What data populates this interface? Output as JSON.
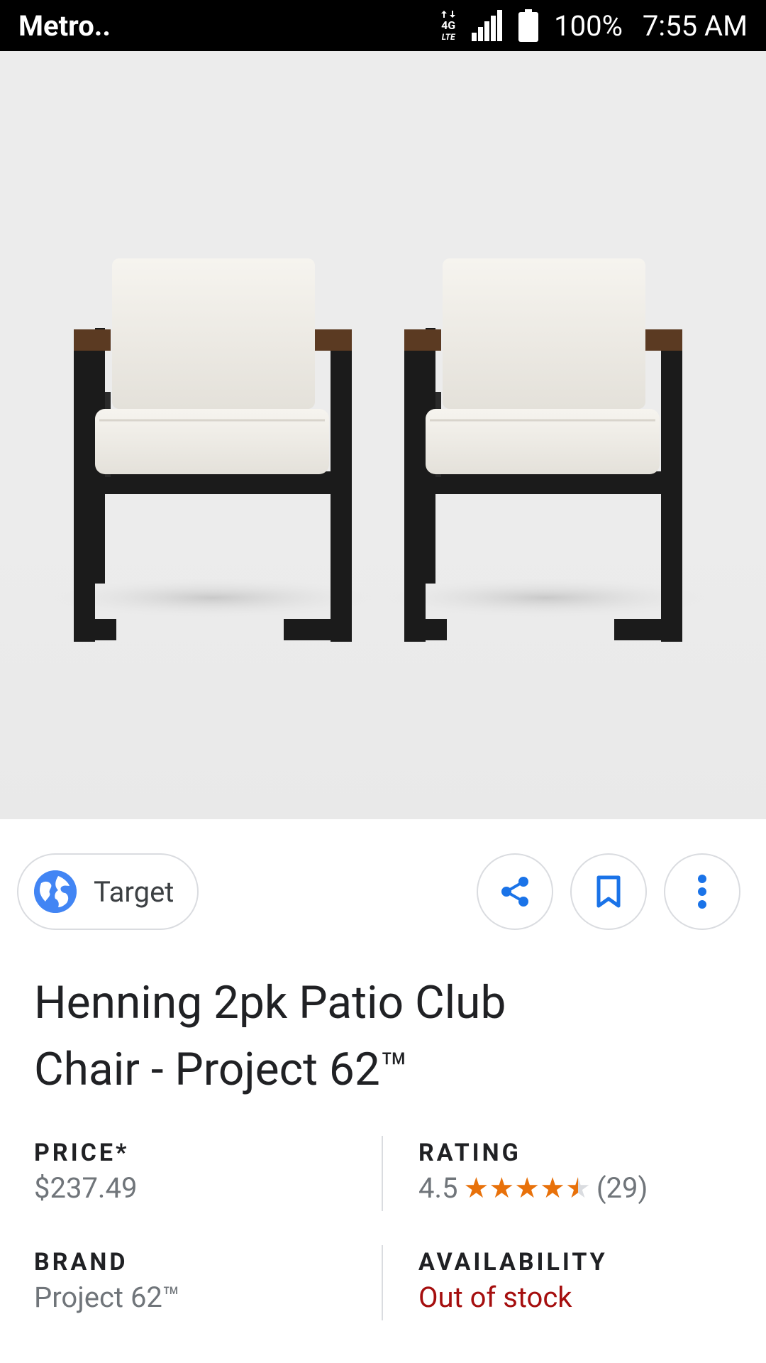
{
  "status_bar": {
    "carrier": "Metro..",
    "network": "4G",
    "network_sub": "LTE",
    "battery": "100%",
    "time": "7:55 AM"
  },
  "product_image": {
    "alt": "Henning 2pk Patio Club Chair"
  },
  "source": {
    "label": "Target",
    "icon": "globe-icon"
  },
  "actions": {
    "share_icon": "share-icon",
    "save_icon": "bookmark-icon",
    "more_icon": "more-vert-icon"
  },
  "product": {
    "title_line1": "Henning 2pk Patio Club",
    "title_line2": "Chair - Project 62™"
  },
  "attributes": {
    "price_label": "PRICE*",
    "price_value": "$237.49",
    "rating_label": "RATING",
    "rating_value": "4.5",
    "rating_stars": 4.5,
    "rating_count": "(29)",
    "brand_label": "BRAND",
    "brand_value": "Project 62™",
    "availability_label": "AVAILABILITY",
    "availability_value": "Out of stock"
  },
  "colors": {
    "accent": "#4285f4",
    "star": "#e8710a",
    "out_of_stock": "#a50e0e"
  }
}
